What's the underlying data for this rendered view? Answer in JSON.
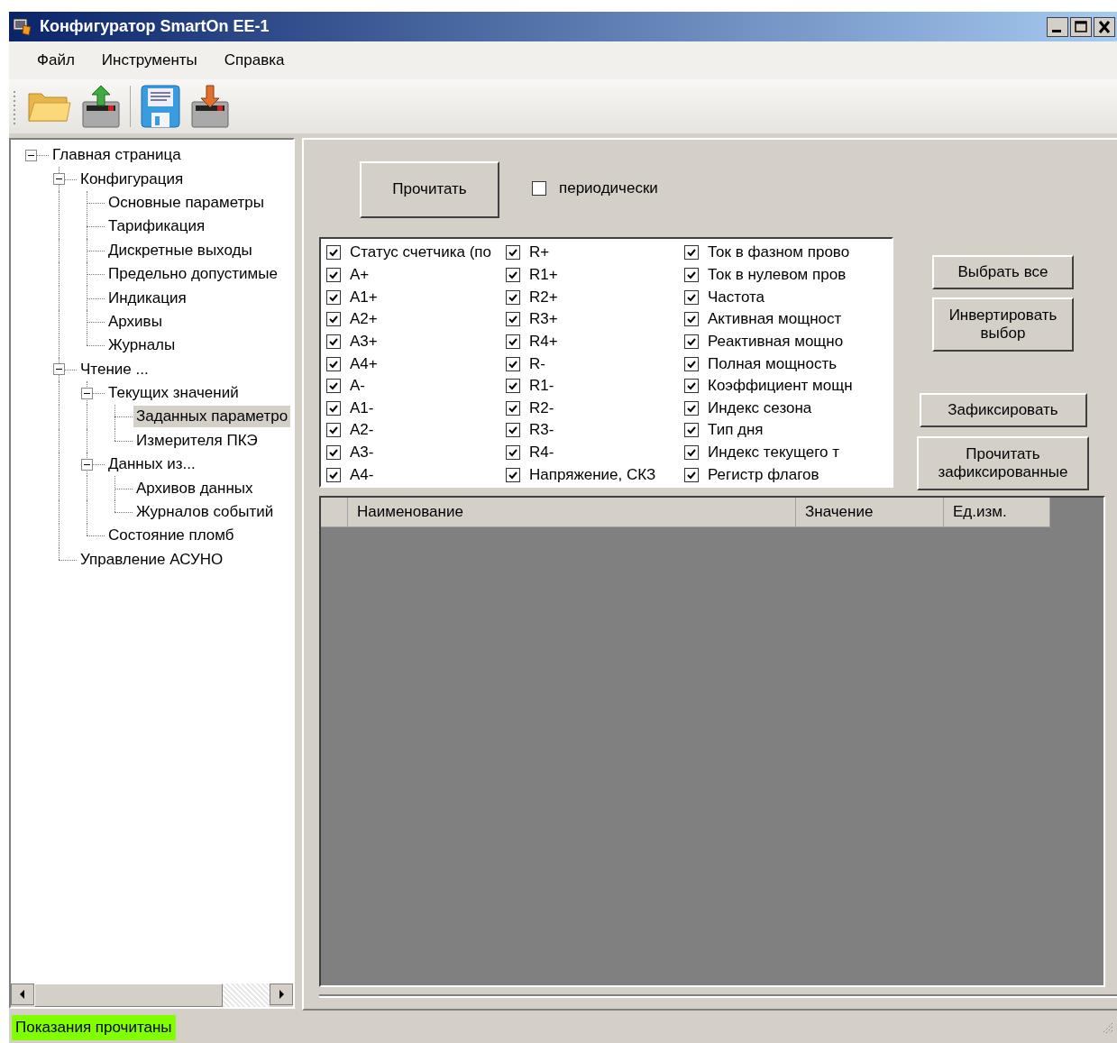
{
  "window": {
    "title": "Конфигуратор SmartOn EE-1"
  },
  "menu": [
    "Файл",
    "Инструменты",
    "Справка"
  ],
  "tree": {
    "items": [
      {
        "label": "Главная страница",
        "expanded": true,
        "selected": false,
        "children": [
          {
            "label": "Конфигурация",
            "expanded": true,
            "selected": false,
            "children": [
              {
                "label": "Основные параметры",
                "selected": false
              },
              {
                "label": "Тарификация",
                "selected": false
              },
              {
                "label": "Дискретные выходы",
                "selected": false
              },
              {
                "label": "Предельно допустимые",
                "selected": false
              },
              {
                "label": "Индикация",
                "selected": false
              },
              {
                "label": "Архивы",
                "selected": false
              },
              {
                "label": "Журналы",
                "selected": false
              }
            ]
          },
          {
            "label": "Чтение ...",
            "expanded": true,
            "selected": false,
            "children": [
              {
                "label": "Текущих значений",
                "expanded": true,
                "selected": false,
                "children": [
                  {
                    "label": "Заданных параметро",
                    "selected": true
                  },
                  {
                    "label": "Измерителя ПКЭ",
                    "selected": false
                  }
                ]
              },
              {
                "label": "Данных из...",
                "expanded": true,
                "selected": false,
                "children": [
                  {
                    "label": "Архивов данных",
                    "selected": false
                  },
                  {
                    "label": "Журналов событий",
                    "selected": false
                  }
                ]
              },
              {
                "label": "Состояние пломб",
                "selected": false
              }
            ]
          },
          {
            "label": "Управление АСУНО",
            "selected": false
          }
        ]
      }
    ]
  },
  "read_button": "Прочитать",
  "periodic": {
    "label": "периодически",
    "checked": false
  },
  "checklist": {
    "columns": [
      [
        {
          "label": "Статус счетчика (по",
          "checked": true
        },
        {
          "label": "A+",
          "checked": true
        },
        {
          "label": "A1+",
          "checked": true
        },
        {
          "label": "A2+",
          "checked": true
        },
        {
          "label": "A3+",
          "checked": true
        },
        {
          "label": "A4+",
          "checked": true
        },
        {
          "label": "A-",
          "checked": true
        },
        {
          "label": "A1-",
          "checked": true
        },
        {
          "label": "A2-",
          "checked": true
        },
        {
          "label": "A3-",
          "checked": true
        },
        {
          "label": "A4-",
          "checked": true
        }
      ],
      [
        {
          "label": "R+",
          "checked": true
        },
        {
          "label": "R1+",
          "checked": true
        },
        {
          "label": "R2+",
          "checked": true
        },
        {
          "label": "R3+",
          "checked": true
        },
        {
          "label": "R4+",
          "checked": true
        },
        {
          "label": "R-",
          "checked": true
        },
        {
          "label": "R1-",
          "checked": true
        },
        {
          "label": "R2-",
          "checked": true
        },
        {
          "label": "R3-",
          "checked": true
        },
        {
          "label": "R4-",
          "checked": true
        },
        {
          "label": "Напряжение, СКЗ",
          "checked": true
        }
      ],
      [
        {
          "label": "Ток в фазном прово",
          "checked": true
        },
        {
          "label": "Ток в нулевом пров",
          "checked": true
        },
        {
          "label": "Частота",
          "checked": true
        },
        {
          "label": "Активная мощност",
          "checked": true
        },
        {
          "label": "Реактивная мощно",
          "checked": true
        },
        {
          "label": "Полная мощность",
          "checked": true
        },
        {
          "label": "Коэффициент мощн",
          "checked": true
        },
        {
          "label": "Индекс сезона",
          "checked": true
        },
        {
          "label": "Тип дня",
          "checked": true
        },
        {
          "label": "Индекс текущего т",
          "checked": true
        },
        {
          "label": "Регистр флагов",
          "checked": true
        }
      ]
    ]
  },
  "side_buttons": [
    "Выбрать все",
    "Инвертировать выбор",
    "Зафиксировать",
    "Прочитать зафиксированные"
  ],
  "table": {
    "columns": [
      "Наименование",
      "Значение",
      "Ед.изм."
    ]
  },
  "status_bar": {
    "text": "Показания прочитаны"
  }
}
